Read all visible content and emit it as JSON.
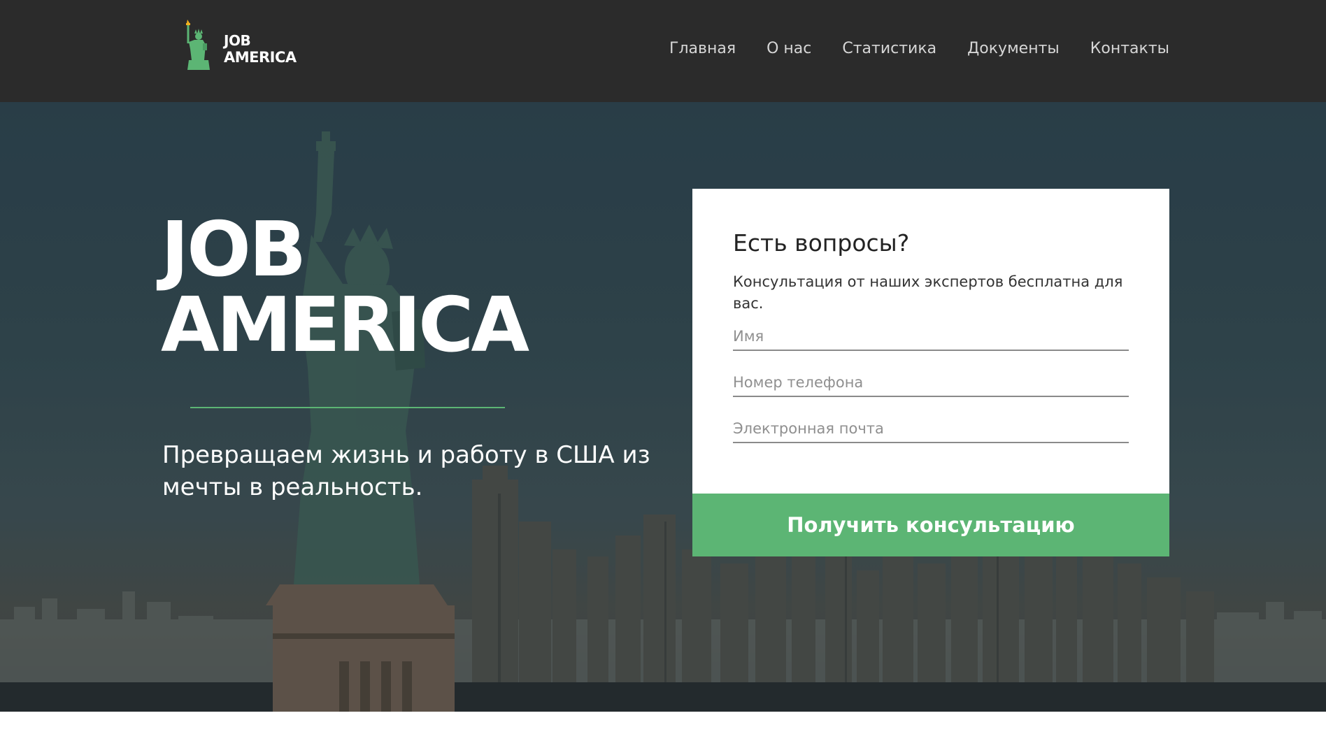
{
  "header": {
    "logo": {
      "line1": "JOB",
      "line2": "AMERICA",
      "icon": "statue-of-liberty-icon"
    },
    "nav": [
      {
        "label": "Главная"
      },
      {
        "label": "О нас"
      },
      {
        "label": "Статистика"
      },
      {
        "label": "Документы"
      },
      {
        "label": "Контакты"
      }
    ]
  },
  "hero": {
    "title_line1": "JOB",
    "title_line2": "AMERICA",
    "subtitle": "Превращаем жизнь и работу в США из мечты в реальность."
  },
  "form": {
    "title": "Есть вопросы?",
    "description": "Консультация от наших экспертов бесплатна для вас.",
    "name_placeholder": "Имя",
    "phone_placeholder": "Номер телефона",
    "email_placeholder": "Электронная почта",
    "submit_label": "Получить консультацию"
  },
  "colors": {
    "header_bg": "#2b2b2b",
    "accent_green": "#5cb574",
    "nav_text": "#d6d6d6",
    "card_bg": "#ffffff"
  }
}
